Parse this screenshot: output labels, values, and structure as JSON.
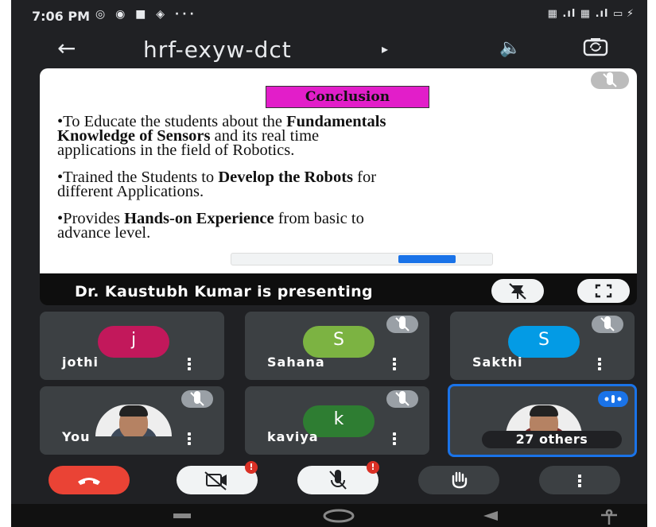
{
  "status_bar": {
    "time": "7:06 PM"
  },
  "header": {
    "meeting_code": "hrf-exyw-dct",
    "caret": "▸"
  },
  "slide": {
    "title": "Conclusion",
    "bullets": [
      {
        "pre": "•To Educate the students about the ",
        "bold": "Fundamentals",
        "post": ""
      },
      {
        "pre": "",
        "bold": "Knowledge   of   Sensors",
        "post": "   and   its   real   time"
      },
      {
        "pre": "applications in the field of Robotics.",
        "bold": "",
        "post": ""
      },
      {
        "pre": "•Trained the Students to ",
        "bold": "Develop the Robots",
        "post": " for"
      },
      {
        "pre": "different Applications.",
        "bold": "",
        "post": ""
      },
      {
        "pre": "•Provides ",
        "bold": "Hands-on  Experience",
        "post": "  from  basic  to"
      },
      {
        "pre": "advance level.",
        "bold": "",
        "post": ""
      }
    ]
  },
  "presentation": {
    "presenter_text": "Dr. Kaustubh Kumar is presenting"
  },
  "participants": [
    {
      "name": "jothi",
      "initial": "j",
      "color": "#c2185b"
    },
    {
      "name": "Sahana",
      "initial": "S",
      "color": "#7cb342"
    },
    {
      "name": "Sakthi",
      "initial": "S",
      "color": "#039be5"
    },
    {
      "name": "You",
      "initial": "",
      "color": ""
    },
    {
      "name": "kaviya",
      "initial": "k",
      "color": "#2e7d32"
    }
  ],
  "others_tile": {
    "label": "27 others"
  },
  "controls": {
    "camera_badge": "!",
    "mic_badge": "!"
  },
  "colors": {
    "background": "#202124",
    "tile": "#3c4043",
    "accent": "#1a73e8",
    "end_call": "#ea4335"
  }
}
